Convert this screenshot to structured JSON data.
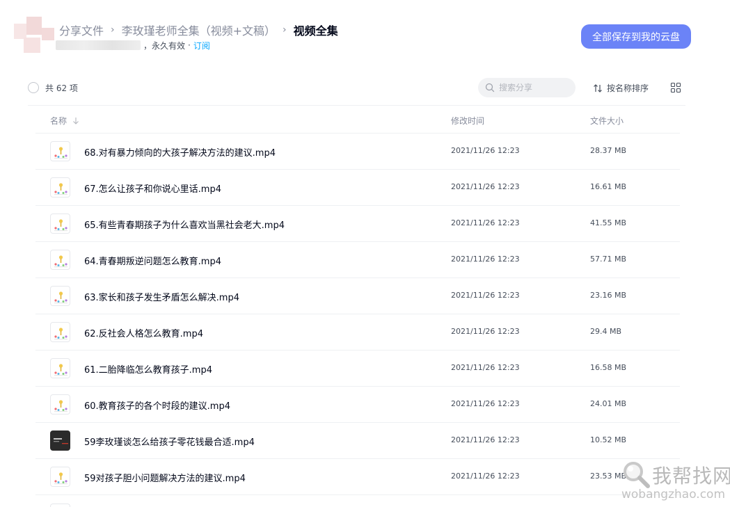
{
  "header": {
    "breadcrumb": [
      "分享文件",
      "李玫瑾老师全集（视频+文稿）"
    ],
    "current": "视频全集",
    "separator": "›",
    "subline_prefix": "，",
    "validity": "永久有效",
    "subline_sep": "·",
    "subscribe": "订阅",
    "save_all": "全部保存到我的云盘"
  },
  "toolbar": {
    "count": "共 62 项",
    "search_placeholder": "搜索分享",
    "sort": "按名称排序"
  },
  "table": {
    "columns": {
      "name": "名称",
      "time": "修改时间",
      "size": "文件大小"
    },
    "rows": [
      {
        "name": "68.对有暴力倾向的大孩子解决方法的建议.mp4",
        "time": "2021/11/26 12:23",
        "size": "28.37 MB",
        "thumb": "light"
      },
      {
        "name": "67.怎么让孩子和你说心里话.mp4",
        "time": "2021/11/26 12:23",
        "size": "16.61 MB",
        "thumb": "light"
      },
      {
        "name": "65.有些青春期孩子为什么喜欢当黑社会老大.mp4",
        "time": "2021/11/26 12:23",
        "size": "41.55 MB",
        "thumb": "light"
      },
      {
        "name": "64.青春期叛逆问题怎么教育.mp4",
        "time": "2021/11/26 12:23",
        "size": "57.71 MB",
        "thumb": "light"
      },
      {
        "name": "63.家长和孩子发生矛盾怎么解决.mp4",
        "time": "2021/11/26 12:23",
        "size": "23.16 MB",
        "thumb": "light"
      },
      {
        "name": "62.反社会人格怎么教育.mp4",
        "time": "2021/11/26 12:23",
        "size": "29.4 MB",
        "thumb": "light"
      },
      {
        "name": "61.二胎降临怎么教育孩子.mp4",
        "time": "2021/11/26 12:23",
        "size": "16.58 MB",
        "thumb": "light"
      },
      {
        "name": "60.教育孩子的各个时段的建议.mp4",
        "time": "2021/11/26 12:23",
        "size": "24.01 MB",
        "thumb": "light"
      },
      {
        "name": "59李玫瑾谈怎么给孩子零花钱最合适.mp4",
        "time": "2021/11/26 12:23",
        "size": "10.52 MB",
        "thumb": "dark"
      },
      {
        "name": "59对孩子胆小问题解决方法的建议.mp4",
        "time": "2021/11/26 12:23",
        "size": "23.53 MB",
        "thumb": "light"
      }
    ]
  },
  "watermark": {
    "text": "我帮找网",
    "sub": "wobangzhao.com"
  },
  "colors": {
    "accent": "#6b83f7",
    "link": "#06a7ff",
    "text": "#03081a",
    "muted": "#878c9c"
  }
}
